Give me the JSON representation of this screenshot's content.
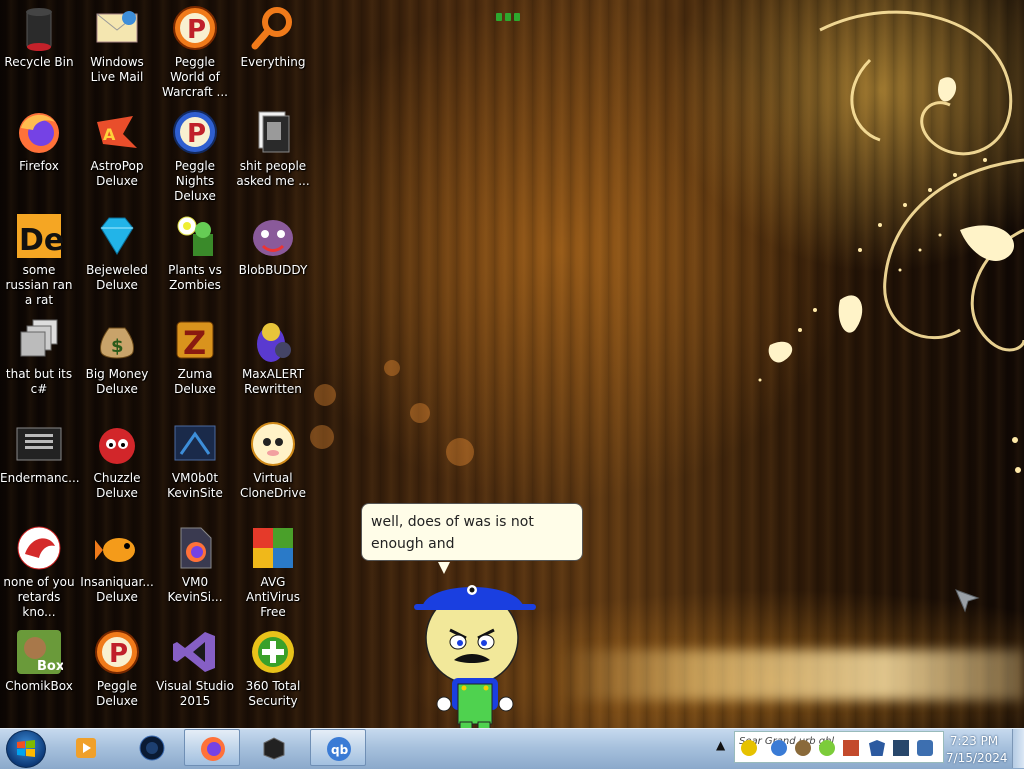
{
  "desktop": {
    "icons": [
      {
        "label": "Recycle Bin",
        "icon": "recycle-bin-icon"
      },
      {
        "label": "Windows Live Mail",
        "icon": "mail-icon"
      },
      {
        "label": "Peggle World of Warcraft ...",
        "icon": "peggle-icon"
      },
      {
        "label": "Everything",
        "icon": "magnifier-icon"
      },
      {
        "label": "Firefox",
        "icon": "firefox-icon"
      },
      {
        "label": "AstroPop Deluxe",
        "icon": "astropop-icon"
      },
      {
        "label": "Peggle Nights Deluxe",
        "icon": "peggle-nights-icon"
      },
      {
        "label": "shit people asked me ...",
        "icon": "document-icon"
      },
      {
        "label": "some russian ran a rat",
        "icon": "de-icon"
      },
      {
        "label": "Bejeweled Deluxe",
        "icon": "gem-icon"
      },
      {
        "label": "Plants vs Zombies",
        "icon": "plant-icon"
      },
      {
        "label": "BlobBUDDY",
        "icon": "blob-icon"
      },
      {
        "label": "that but its c#",
        "icon": "windows-stack-icon"
      },
      {
        "label": "Big Money Deluxe",
        "icon": "money-bag-icon"
      },
      {
        "label": "Zuma Deluxe",
        "icon": "zuma-icon"
      },
      {
        "label": "MaxALERT Rewritten",
        "icon": "parrot-icon"
      },
      {
        "label": "Endermanc...",
        "icon": "console-icon"
      },
      {
        "label": "Chuzzle Deluxe",
        "icon": "chuzzle-icon"
      },
      {
        "label": "VM0b0t KevinSite",
        "icon": "vm-icon"
      },
      {
        "label": "Virtual CloneDrive",
        "icon": "sheep-icon"
      },
      {
        "label": "none of you retards kno...",
        "icon": "dragon-icon"
      },
      {
        "label": "Insaniquar... Deluxe",
        "icon": "fish-icon"
      },
      {
        "label": "VM0 KevinSi...",
        "icon": "firefox-file-icon"
      },
      {
        "label": "AVG AntiVirus Free",
        "icon": "avg-icon"
      },
      {
        "label": "ChomikBox",
        "icon": "chomikbox-icon"
      },
      {
        "label": "Peggle Deluxe",
        "icon": "peggle-icon"
      },
      {
        "label": "Visual Studio 2015",
        "icon": "visual-studio-icon"
      },
      {
        "label": "360 Total Security",
        "icon": "shield-plus-icon"
      }
    ]
  },
  "assistant": {
    "speech": "well, does of was is not enough and"
  },
  "taskbar": {
    "pinned": [
      {
        "name": "media-player-icon"
      },
      {
        "name": "app-circle-icon"
      },
      {
        "name": "firefox-icon"
      },
      {
        "name": "vm-box-icon"
      },
      {
        "name": "qbittorrent-icon"
      }
    ],
    "tray_marquee": "Sear  Grand  urb  ghl",
    "clock_time": "7:23 PM",
    "clock_date": "7/15/2024"
  },
  "colors": {
    "taskbar": "#a7c1dd",
    "bubble": "#fffde8",
    "hat": "#1a3fe0",
    "overalls": "#4fd24f"
  }
}
